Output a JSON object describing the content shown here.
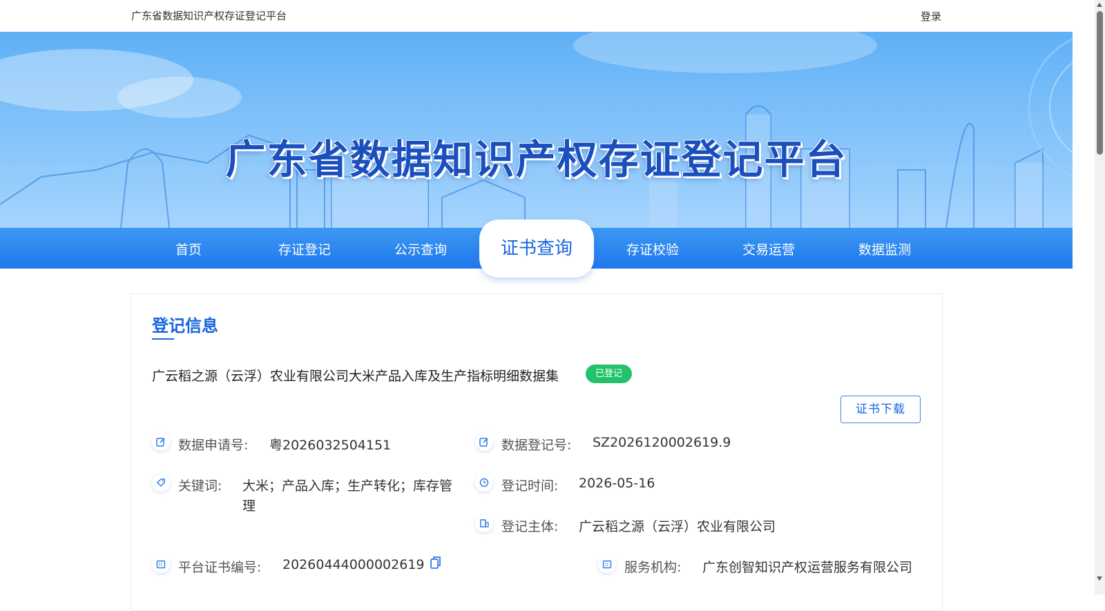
{
  "header": {
    "site_title": "广东省数据知识产权存证登记平台",
    "login_label": "登录"
  },
  "banner": {
    "title": "广东省数据知识产权存证登记平台"
  },
  "nav": {
    "items": [
      {
        "label": "首页"
      },
      {
        "label": "存证登记"
      },
      {
        "label": "公示查询"
      },
      {
        "label": "证书查询"
      },
      {
        "label": "存证校验"
      },
      {
        "label": "交易运营"
      },
      {
        "label": "数据监测"
      }
    ],
    "active_label": "证书查询"
  },
  "registration": {
    "section_title": "登记信息",
    "dataset_name": "广云稻之源（云浮）农业有限公司大米产品入库及生产指标明细数据集",
    "status": "已登记",
    "download_label": "证书下载",
    "fields": {
      "application_no_label": "数据申请号:",
      "application_no": "粤2026032504151",
      "registration_no_label": "数据登记号:",
      "registration_no": "SZ2026120002619.9",
      "keywords_label": "关键词:",
      "keywords_line1": "大米；产品入库；生产转化；库存管",
      "keywords_line2": "理",
      "reg_time_label": "登记时间:",
      "reg_time": "2026-05-16",
      "reg_subject_label": "登记主体:",
      "reg_subject": "广云稻之源（云浮）农业有限公司",
      "cert_no_label": "平台证书编号:",
      "cert_no": "20260444000002619",
      "service_org_label": "服务机构:",
      "service_org": "广东创智知识产权运营服务有限公司"
    }
  },
  "colors": {
    "accent": "#1665e0",
    "nav_bg": "#2a86ef",
    "status_green": "#23c36b"
  }
}
